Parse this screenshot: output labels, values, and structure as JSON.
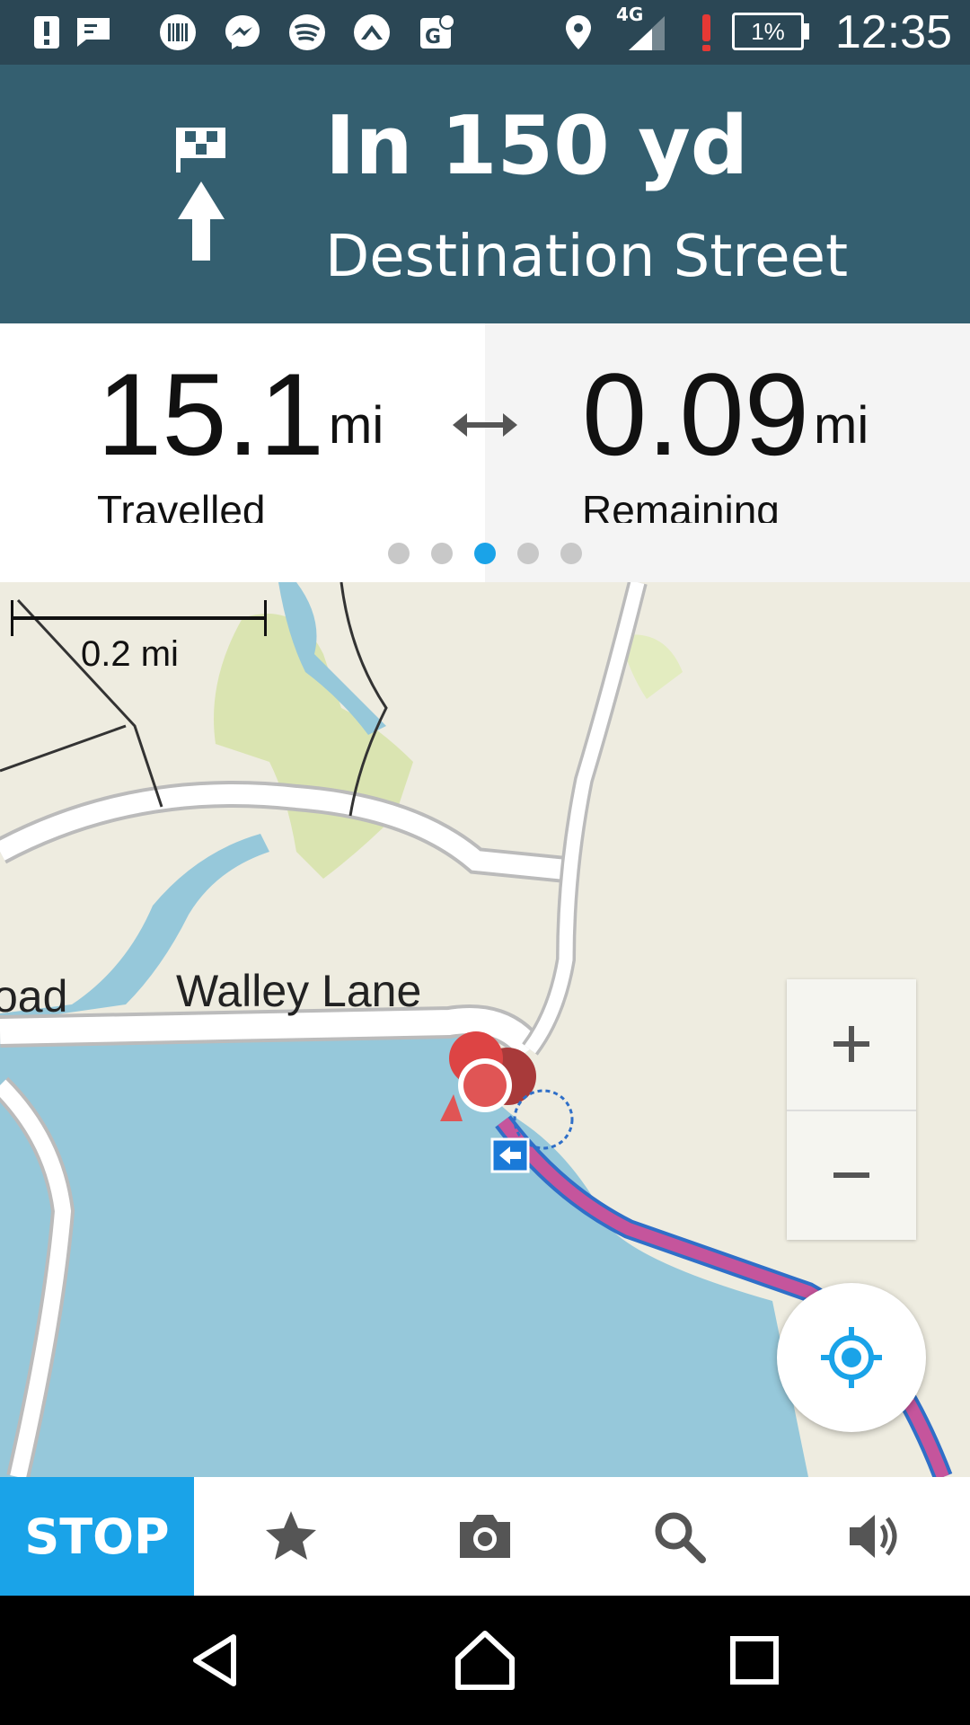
{
  "status_bar": {
    "time": "12:35",
    "network_type": "4G",
    "battery_percent": "1%",
    "icons": [
      "alert-icon",
      "message-icon",
      "barcode-app-icon",
      "messenger-icon",
      "spotify-icon",
      "app-icon",
      "maps-icon",
      "location-icon",
      "signal-icon",
      "warning-icon",
      "battery-icon"
    ]
  },
  "navigation": {
    "distance": "In 150 yd",
    "street": "Destination Street",
    "turn_icon": "straight-to-destination-icon"
  },
  "stats": {
    "travelled_value": "15.1",
    "travelled_unit": "mi",
    "travelled_label": "Travelled",
    "remaining_value": "0.09",
    "remaining_unit": "mi",
    "remaining_label": "Remaining",
    "page_count": 5,
    "active_page": 3
  },
  "map": {
    "scale_label": "0.2 mi",
    "road_label": "Walley Lane",
    "road_label_partial": "oad",
    "colors": {
      "water": "#96c8da",
      "land": "#eeece0",
      "park": "#d6e3a8",
      "route": "#c5559c",
      "route_outline": "#2f6fc8"
    }
  },
  "toolbar": {
    "stop_label": "STOP",
    "icons": [
      "star-icon",
      "camera-icon",
      "search-icon",
      "volume-icon"
    ]
  },
  "colors": {
    "header": "#345f70",
    "status_bar": "#2b4755",
    "accent": "#1aa3e8"
  }
}
